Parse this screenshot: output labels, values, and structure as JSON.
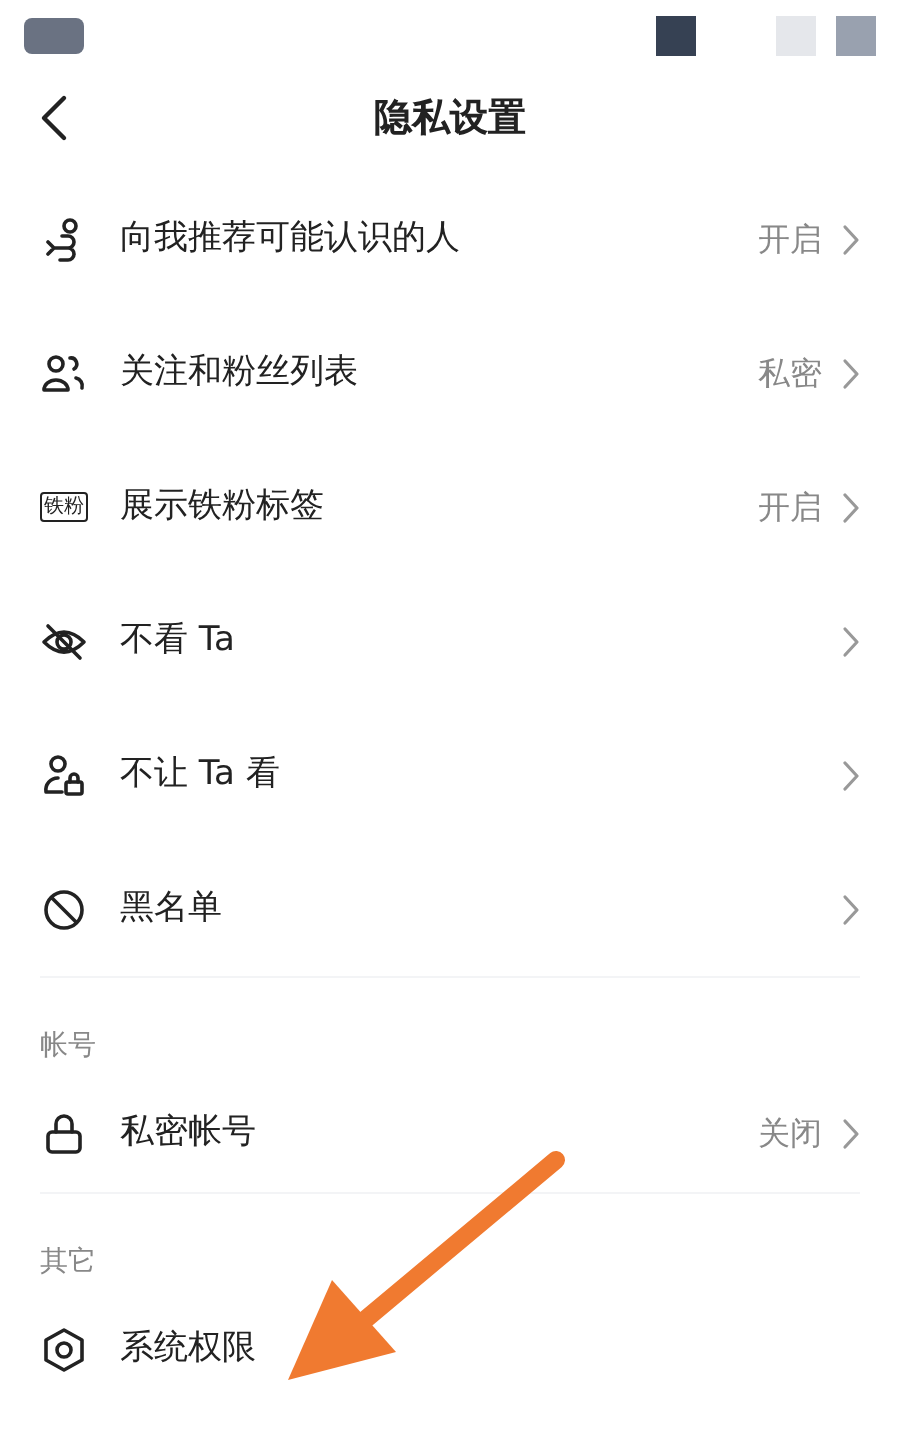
{
  "header": {
    "title": "隐私设置"
  },
  "sections": [
    {
      "items": [
        {
          "kind": "recommend",
          "label": "向我推荐可能认识的人",
          "value": "开启",
          "chevron": true
        },
        {
          "kind": "people",
          "label": "关注和粉丝列表",
          "value": "私密",
          "chevron": true
        },
        {
          "kind": "badge",
          "badge_text": "铁粉",
          "label": "展示铁粉标签",
          "value": "开启",
          "chevron": true
        },
        {
          "kind": "eye-off",
          "label": "不看 Ta",
          "chevron": true
        },
        {
          "kind": "person-lock",
          "label": "不让 Ta 看",
          "chevron": true
        },
        {
          "kind": "block",
          "label": "黑名单",
          "chevron": true
        }
      ]
    },
    {
      "title": "帐号",
      "items": [
        {
          "kind": "lock",
          "label": "私密帐号",
          "value": "关闭",
          "chevron": true
        }
      ]
    },
    {
      "title": "其它",
      "items": [
        {
          "kind": "hexagon",
          "label": "系统权限",
          "chevron": false
        }
      ]
    }
  ]
}
